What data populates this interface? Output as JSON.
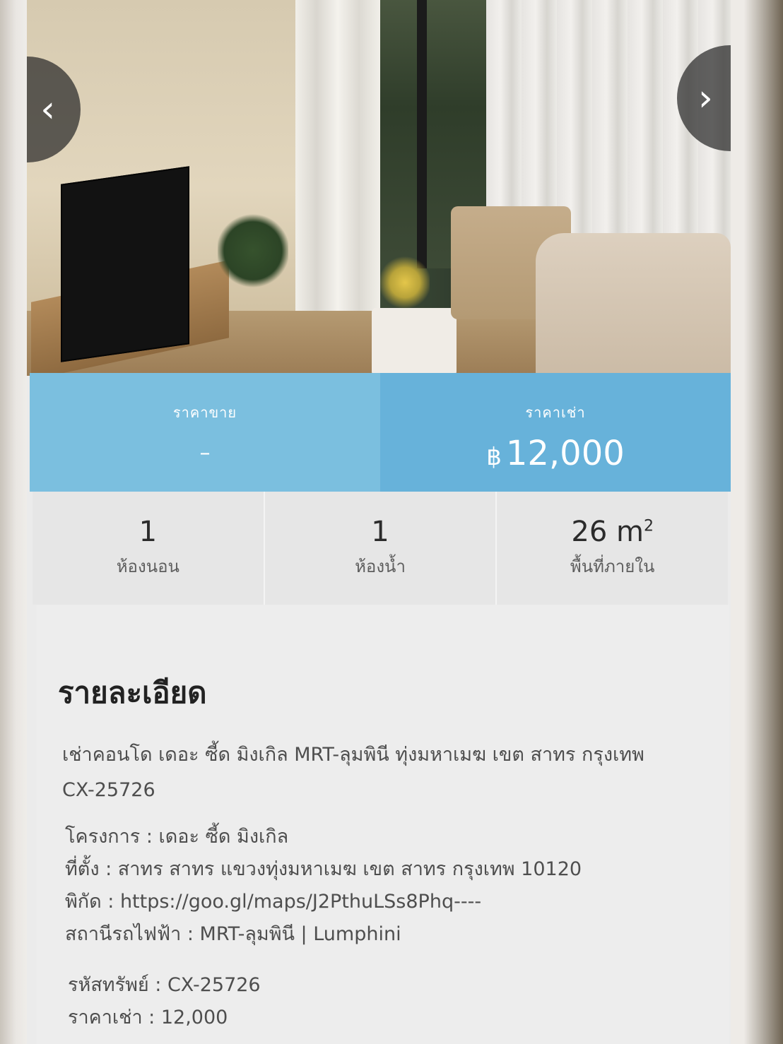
{
  "gallery": {
    "prev_icon": "‹",
    "next_icon": "›"
  },
  "prices": {
    "sale_label": "ราคาขาย",
    "sale_value": "–",
    "rent_label": "ราคาเช่า",
    "rent_currency": "฿",
    "rent_value": "12,000"
  },
  "stats": {
    "bedrooms_value": "1",
    "bedrooms_label": "ห้องนอน",
    "bathrooms_value": "1",
    "bathrooms_label": "ห้องน้ำ",
    "area_value": "26 m",
    "area_unit_sup": "2",
    "area_label": "พื้นที่ภายใน"
  },
  "details": {
    "title": "รายละเอียด",
    "description": "เช่าคอนโด เดอะ ซี้ด มิงเกิล MRT-ลุมพินี ทุ่งมหาเมฆ เขต สาทร กรุงเทพ CX-25726",
    "project": "โครงการ : เดอะ ซี้ด มิงเกิล",
    "location": "ที่ตั้ง : สาทร สาทร แขวงทุ่งมหาเมฆ เขต สาทร กรุงเทพ 10120",
    "coordinates": "พิกัด : https://goo.gl/maps/J2PthuLSs8Phq----",
    "train_station": "สถานีรถไฟฟ้า : MRT-ลุมพินี | Lumphini",
    "property_code": "รหัสทรัพย์ : CX-25726",
    "rent_price": "ราคาเช่า : 12,000"
  }
}
